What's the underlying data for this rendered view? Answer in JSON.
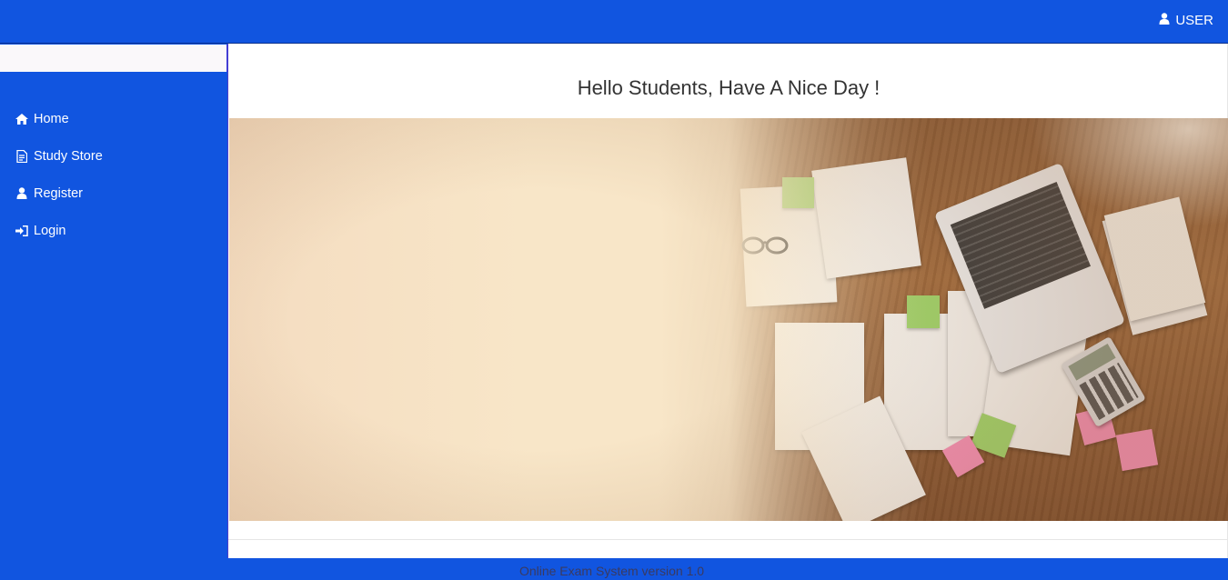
{
  "header": {
    "user_label": "USER",
    "user_icon": "user-icon"
  },
  "sidebar": {
    "items": [
      {
        "label": "Home",
        "icon": "home-icon"
      },
      {
        "label": "Study Store",
        "icon": "document-icon"
      },
      {
        "label": "Register",
        "icon": "user-icon"
      },
      {
        "label": "Login",
        "icon": "sign-in-icon"
      }
    ]
  },
  "main": {
    "greeting": "Hello Students, Have A Nice Day !"
  },
  "footer": {
    "text": "Online Exam System version 1.0"
  },
  "colors": {
    "brand_blue": "#1155e0",
    "greeting_text": "#333333"
  }
}
